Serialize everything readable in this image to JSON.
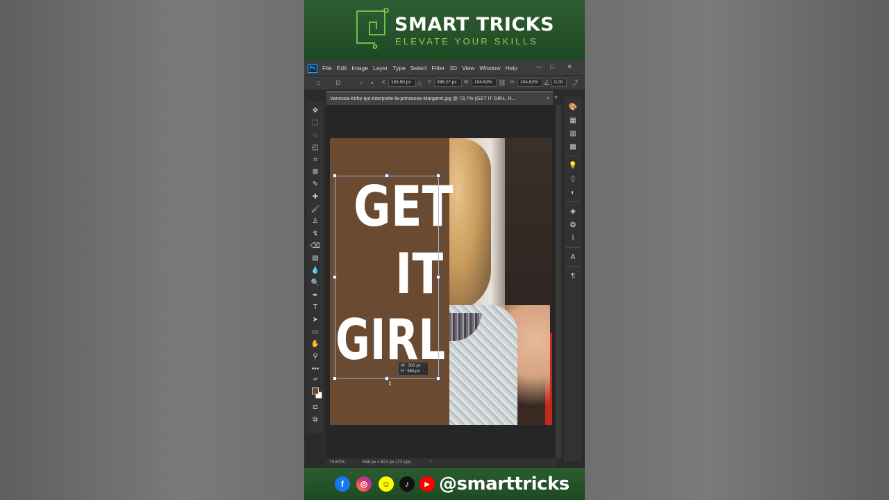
{
  "banner": {
    "title": "SMART TRICKS",
    "subtitle": "ELEVATE YOUR SKILLS",
    "logo_icon": "smart-tricks-logo"
  },
  "app": {
    "logo": "Ps",
    "menu": [
      "File",
      "Edit",
      "Image",
      "Layer",
      "Type",
      "Select",
      "Filter",
      "3D",
      "View",
      "Window",
      "Help"
    ],
    "window_controls": [
      "—",
      "□",
      "✕"
    ]
  },
  "options_bar": {
    "x_label": "X:",
    "x_value": "163.90 px",
    "y_label": "Y:",
    "y_value": "398.27 px",
    "w_label": "W:",
    "w_value": "104.62%",
    "h_label": "H:",
    "h_value": "104.62%",
    "angle_value": "0.00"
  },
  "document": {
    "tab_title": "Vanessa-Kirby-qui-interprete-la-princesse-Margaret.jpg @ 73.7% (GET IT GIRL, R...",
    "close": "×",
    "collapse": "»"
  },
  "canvas": {
    "text_line_1": "GET",
    "text_line_2": "IT",
    "text_line_3": "GIRL",
    "tooltip_w": "W :   300 px",
    "tooltip_h": "H :   584 px",
    "colors": {
      "background": "#6a4a31",
      "text": "#ffffff",
      "selection": "#a9b7d6"
    }
  },
  "status": {
    "zoom": "73.67%",
    "info": "638 px x 821 px (72 ppi)",
    "arrow": "›"
  },
  "footer": {
    "handle": "@smarttricks",
    "socials": [
      "facebook-icon",
      "instagram-icon",
      "snapchat-icon",
      "tiktok-icon",
      "youtube-icon"
    ]
  }
}
